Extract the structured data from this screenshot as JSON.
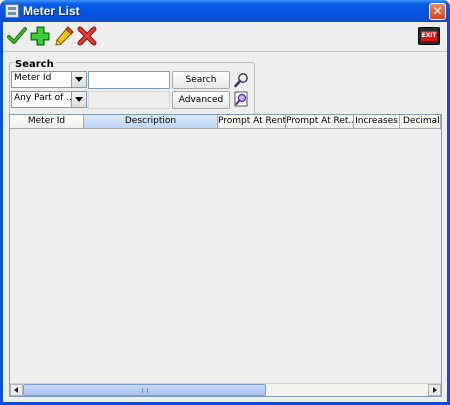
{
  "window": {
    "title": "Meter List",
    "close_symbol": "✕"
  },
  "toolbar": {
    "buttons": [
      {
        "name": "accept-icon",
        "color": "#2e8b1f"
      },
      {
        "name": "add-icon",
        "color": "#2cb22c"
      },
      {
        "name": "edit-pencil-icon",
        "color": "#e6b800"
      },
      {
        "name": "delete-icon",
        "color": "#d02020"
      }
    ],
    "exit_label": "EXIT"
  },
  "search": {
    "legend": "Search",
    "field_combo": "Meter Id",
    "match_combo": "Any Part of ...",
    "text_value": "",
    "search_button": "Search",
    "advanced_button": "Advanced"
  },
  "table": {
    "columns": [
      "Meter Id",
      "Description",
      "Prompt At Rent",
      "Prompt At Ret...",
      "Increases",
      "Decimal P"
    ],
    "selected_column": "Description",
    "rows": []
  },
  "colors": {
    "titlebar": "#0454e2",
    "client_bg": "#eeeeee",
    "header_selected": "#b9d3f5"
  }
}
